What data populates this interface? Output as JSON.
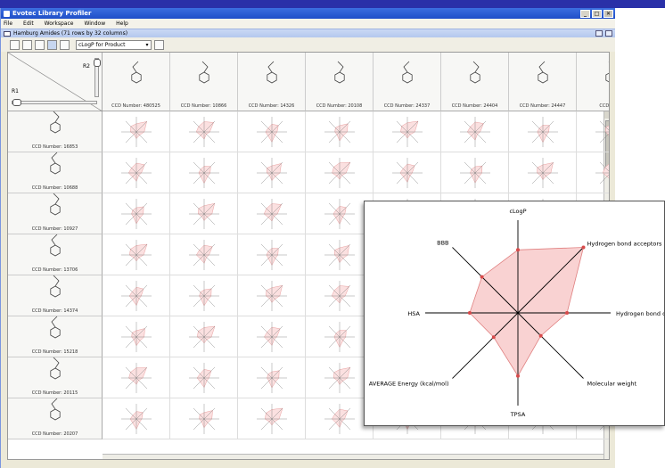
{
  "app": {
    "title": "Evotec Library Profiler",
    "document_title": "Hamburg Amides (71 rows by 32 columns)",
    "window_controls": {
      "minimize": "_",
      "maximize": "□",
      "close": "✕"
    }
  },
  "menubar": {
    "items": [
      "File",
      "Edit",
      "Workspace",
      "Window",
      "Help"
    ]
  },
  "toolbar": {
    "property_select": "cLogP for Product"
  },
  "grid": {
    "corner_r2": "R2",
    "corner_r1": "R1",
    "columns": [
      {
        "label": "CCD Number: 480525"
      },
      {
        "label": "CCD Number: 10866"
      },
      {
        "label": "CCD Number: 14326"
      },
      {
        "label": "CCD Number: 20108"
      },
      {
        "label": "CCD Number: 24337"
      },
      {
        "label": "CCD Number: 24404"
      },
      {
        "label": "CCD Number: 24447"
      },
      {
        "label": "CCD Num"
      }
    ],
    "rows": [
      {
        "label": "CCD Number: 16853"
      },
      {
        "label": "CCD Number: 10688"
      },
      {
        "label": "CCD Number: 10927"
      },
      {
        "label": "CCD Number: 13706"
      },
      {
        "label": "CCD Number: 14374"
      },
      {
        "label": "CCD Number: 15218"
      },
      {
        "label": "CCD Number: 20115"
      },
      {
        "label": "CCD Number: 20207"
      }
    ]
  },
  "popup_chart": {
    "axes": [
      "cLogP",
      "Hydrogen bond acceptors",
      "Hydrogen bond do",
      "Molecular weight",
      "TPSA",
      "AVERAGE Energy (kcal/mol)",
      "HSA",
      "BBB"
    ],
    "values": [
      0.68,
      1.0,
      0.53,
      0.35,
      0.68,
      0.37,
      0.52,
      0.55
    ],
    "fill_color": "#f9d2d2",
    "stroke_color": "#e08080",
    "point_color": "#d84a4a",
    "axis_color": "#000000"
  },
  "chart_data": {
    "type": "radar",
    "categories": [
      "cLogP",
      "Hydrogen bond acceptors",
      "Hydrogen bond do",
      "Molecular weight",
      "TPSA",
      "AVERAGE Energy (kcal/mol)",
      "HSA",
      "BBB"
    ],
    "values": [
      0.68,
      1.0,
      0.53,
      0.35,
      0.68,
      0.37,
      0.52,
      0.55
    ]
  }
}
